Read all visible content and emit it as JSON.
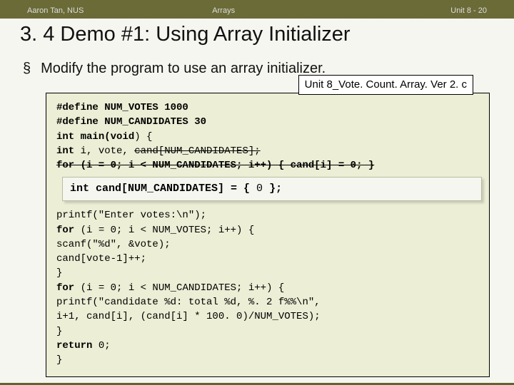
{
  "header": {
    "left": "Aaron Tan, NUS",
    "center": "Arrays",
    "right": "Unit 8 - 20"
  },
  "title": "3. 4 Demo #1: Using Array Initializer",
  "bullet": {
    "mark": "§",
    "text": "Modify the program to use an array initializer."
  },
  "file_label": "Unit 8_Vote. Count. Array. Ver 2. c",
  "code": {
    "l1a": "#define NUM_VOTES 1000",
    "l2a": "#define NUM_CANDIDATES 30",
    "l3a": "int",
    "l3b": " main(",
    "l3c": "void",
    "l3d": ") {",
    "l4a": "    int",
    "l4b": " i, vote, ",
    "l4c": "cand[NUM_CANDIDATES];",
    "l5a": "    ",
    "l5b": "for (i = 0; i < NUM_CANDIDATES; i++) { cand[i] = 0; }",
    "inset_pre": "int cand[NUM_CANDIDATES] = {",
    "inset_val": " 0 ",
    "inset_post": "};",
    "l7": "   printf(\"Enter votes:\\n\");",
    "l8a": "   for",
    "l8b": " (i = 0; i < NUM_VOTES; i++) {",
    "l9": "       scanf(\"%d\", &vote);",
    "l10": "       cand[vote-1]++;",
    "l11": "   }",
    "l12a": "   for",
    "l12b": " (i = 0; i < NUM_CANDIDATES; i++) {",
    "l13": "       printf(\"candidate %d: total %d, %. 2 f%%\\n\",",
    "l14": "              i+1, cand[i], (cand[i] * 100. 0)/NUM_VOTES);",
    "l15": "   }",
    "l16a": "   return",
    "l16b": " 0;",
    "l17": "}"
  }
}
